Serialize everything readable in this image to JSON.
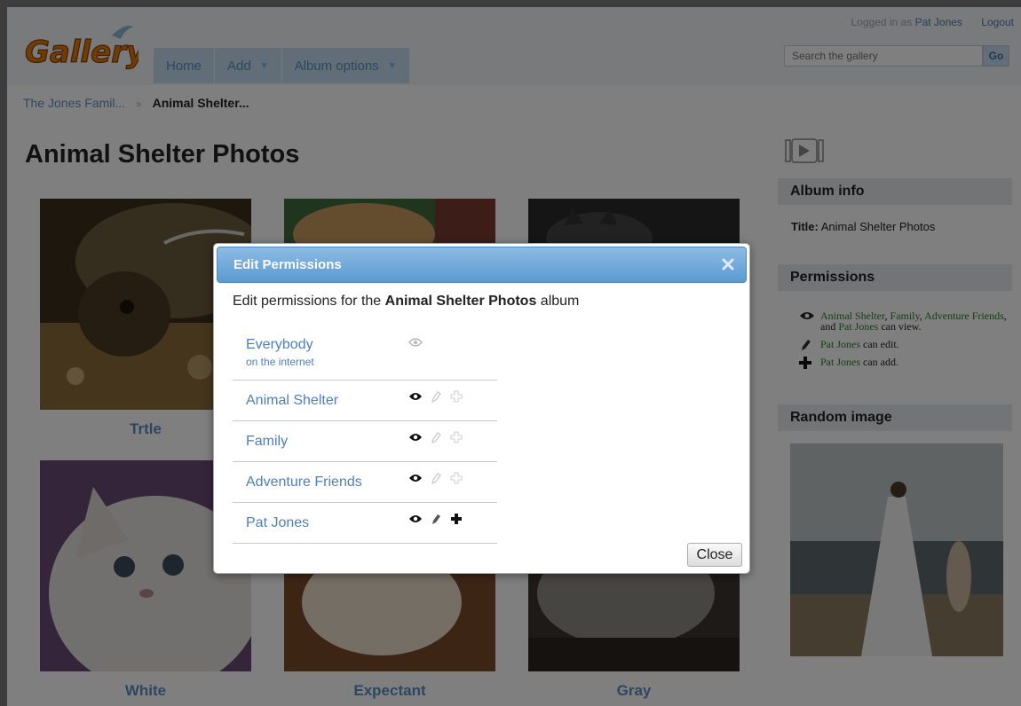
{
  "header": {
    "logo_text": "Gallery",
    "nav": [
      "Home",
      "Add",
      "Album options"
    ],
    "login_prefix": "Logged in as",
    "user": "Pat Jones",
    "logout": "Logout",
    "search_placeholder": "Search the gallery",
    "search_go": "Go"
  },
  "breadcrumb": {
    "parent": "The Jones Famil...",
    "separator": "»",
    "current": "Animal Shelter..."
  },
  "album": {
    "title": "Animal Shelter Photos",
    "photos": [
      {
        "caption": "Trtle"
      },
      {
        "caption": ""
      },
      {
        "caption": ""
      },
      {
        "caption": "White"
      },
      {
        "caption": "Expectant"
      },
      {
        "caption": "Gray"
      }
    ]
  },
  "sidebar": {
    "album_info_title": "Album info",
    "info_label": "Title:",
    "info_value": "Animal Shelter Photos",
    "permissions_title": "Permissions",
    "perm_view": {
      "g1": "Animal Shelter",
      "t1": ", ",
      "g2": "Family",
      "t2": ", ",
      "g3": "Adventure Friends",
      "t3": ", and ",
      "g4": "Pat Jones",
      "t4": " can view."
    },
    "perm_edit": {
      "user": "Pat Jones",
      "text": " can edit."
    },
    "perm_add": {
      "user": "Pat Jones",
      "text": " can add."
    },
    "random_image_title": "Random image"
  },
  "dialog": {
    "title": "Edit Permissions",
    "intro_prefix": "Edit permissions for the",
    "intro_album": "Animal Shelter Photos",
    "intro_suffix": "album",
    "rows": [
      {
        "name": "Everybody",
        "sub": "on the internet",
        "view": "partial",
        "edit": "none",
        "add": "none"
      },
      {
        "name": "Animal Shelter",
        "view": "on",
        "edit": "off",
        "add": "off"
      },
      {
        "name": "Family",
        "view": "on",
        "edit": "off",
        "add": "off"
      },
      {
        "name": "Adventure Friends",
        "view": "on",
        "edit": "off",
        "add": "off"
      },
      {
        "name": "Pat Jones",
        "view": "on",
        "edit": "on",
        "add": "on"
      }
    ],
    "close_label": "Close"
  },
  "colors": {
    "accent_blue": "#5b9ad2",
    "link_blue": "#4d7fc0",
    "permission_green": "#2a7a2a",
    "overlay": "rgba(0,0,0,0.5)"
  }
}
